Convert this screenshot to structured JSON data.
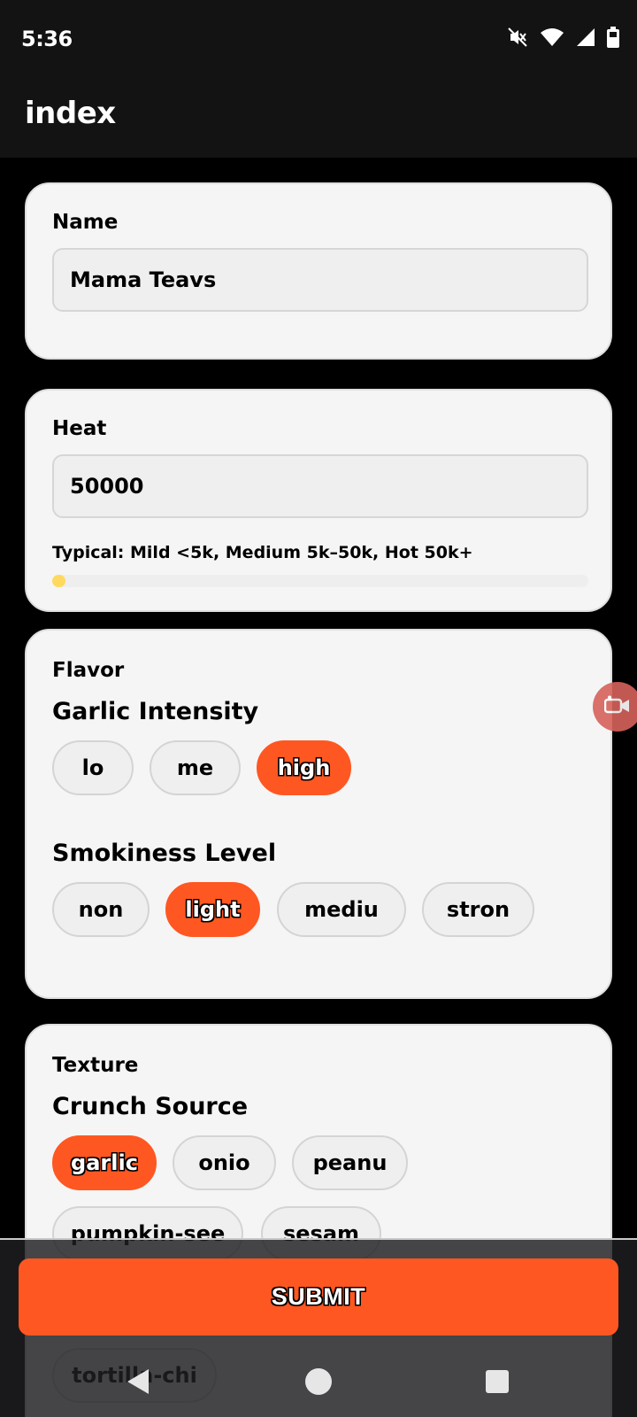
{
  "status_bar": {
    "time": "5:36"
  },
  "app_bar": {
    "title": "index"
  },
  "name_card": {
    "label": "Name",
    "value": "Mama Teavs"
  },
  "heat_card": {
    "label": "Heat",
    "value": "50000",
    "hint": "Typical: Mild <5k, Medium 5k–50k, Hot 50k+",
    "meter_fill_fraction": 0.025,
    "meter_color": "#ffd95e"
  },
  "flavor_card": {
    "section": "Flavor",
    "garlic": {
      "title": "Garlic Intensity",
      "options": [
        "lo",
        "me",
        "high"
      ],
      "selected": "high"
    },
    "smokiness": {
      "title": "Smokiness Level",
      "options": [
        "non",
        "light",
        "mediu",
        "stron"
      ],
      "selected": "light"
    }
  },
  "texture_card": {
    "section": "Texture",
    "crunch": {
      "title": "Crunch Source",
      "options": [
        "garlic",
        "onio",
        "peanu",
        "pumpkin-see",
        "sesam",
        "tortilla-chi"
      ],
      "selected": "garlic"
    }
  },
  "submit": {
    "label": "SUBMIT"
  },
  "colors": {
    "accent": "#ff5722",
    "card": "#f5f5f5",
    "background": "#000000",
    "app_bar": "#131313"
  },
  "nav_icons": [
    "back-icon",
    "home-icon",
    "recents-icon"
  ]
}
